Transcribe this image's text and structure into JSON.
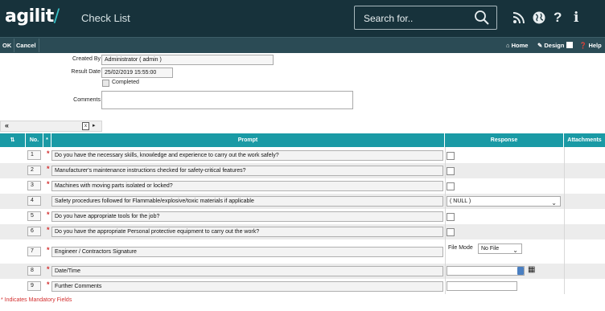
{
  "header": {
    "logo_text": "agilit",
    "logo_slash": "/",
    "title": "Check List",
    "search_placeholder": "Search for..",
    "icons": [
      "rss-icon",
      "globe-icon",
      "help-icon",
      "info-icon"
    ]
  },
  "toolbar": {
    "ok_label": "OK",
    "cancel_label": "Cancel",
    "home_label": "Home",
    "design_label": "Design",
    "help_label": "Help"
  },
  "form": {
    "created_by_label": "Created By",
    "created_by_value": "Administrator ( admin )",
    "result_date_label": "Result Date",
    "result_date_value": "25/02/2019 15:55:00",
    "completed_label": "Completed",
    "comments_label": "Comments",
    "comments_value": ""
  },
  "table": {
    "headers": {
      "no": "No.",
      "mandatory": "*",
      "prompt": "Prompt",
      "response": "Response",
      "attachments": "Attachments"
    },
    "rows": [
      {
        "no": "1",
        "mandatory": true,
        "prompt": "Do you have the necessary skills, knowledge and experience to carry out the work safely?",
        "response_type": "checkbox"
      },
      {
        "no": "2",
        "mandatory": true,
        "prompt": "Manufacturer's maintenance instructions checked for safety-critical features?",
        "response_type": "checkbox"
      },
      {
        "no": "3",
        "mandatory": true,
        "prompt": "Machines with moving parts isolated or locked?",
        "response_type": "checkbox"
      },
      {
        "no": "4",
        "mandatory": false,
        "prompt": "Safety procedures followed for Flammable/explosive/toxic materials if applicable",
        "response_type": "select",
        "response_value": "( NULL )"
      },
      {
        "no": "5",
        "mandatory": true,
        "prompt": "Do you have appropriate tools for the job?",
        "response_type": "checkbox"
      },
      {
        "no": "6",
        "mandatory": true,
        "prompt": "Do you have the appropriate Personal protective equipment to carry out the work?",
        "response_type": "checkbox"
      },
      {
        "no": "7",
        "mandatory": true,
        "prompt": "Engineer / Contractors Signature",
        "response_type": "file",
        "file_mode_label": "File Mode",
        "file_mode_value": "No File"
      },
      {
        "no": "8",
        "mandatory": true,
        "prompt": "Date/Time",
        "response_type": "datetime",
        "response_value": ""
      },
      {
        "no": "9",
        "mandatory": true,
        "prompt": "Further Comments",
        "response_type": "text",
        "response_value": ""
      }
    ]
  },
  "footer_note": "* Indicates Mandatory Fields",
  "colors": {
    "header_bg": "#17323b",
    "toolbar_bg": "#2b4b55",
    "table_header_bg": "#1a9aa5",
    "mandatory": "#d32f2f",
    "accent": "#36c2c9"
  }
}
